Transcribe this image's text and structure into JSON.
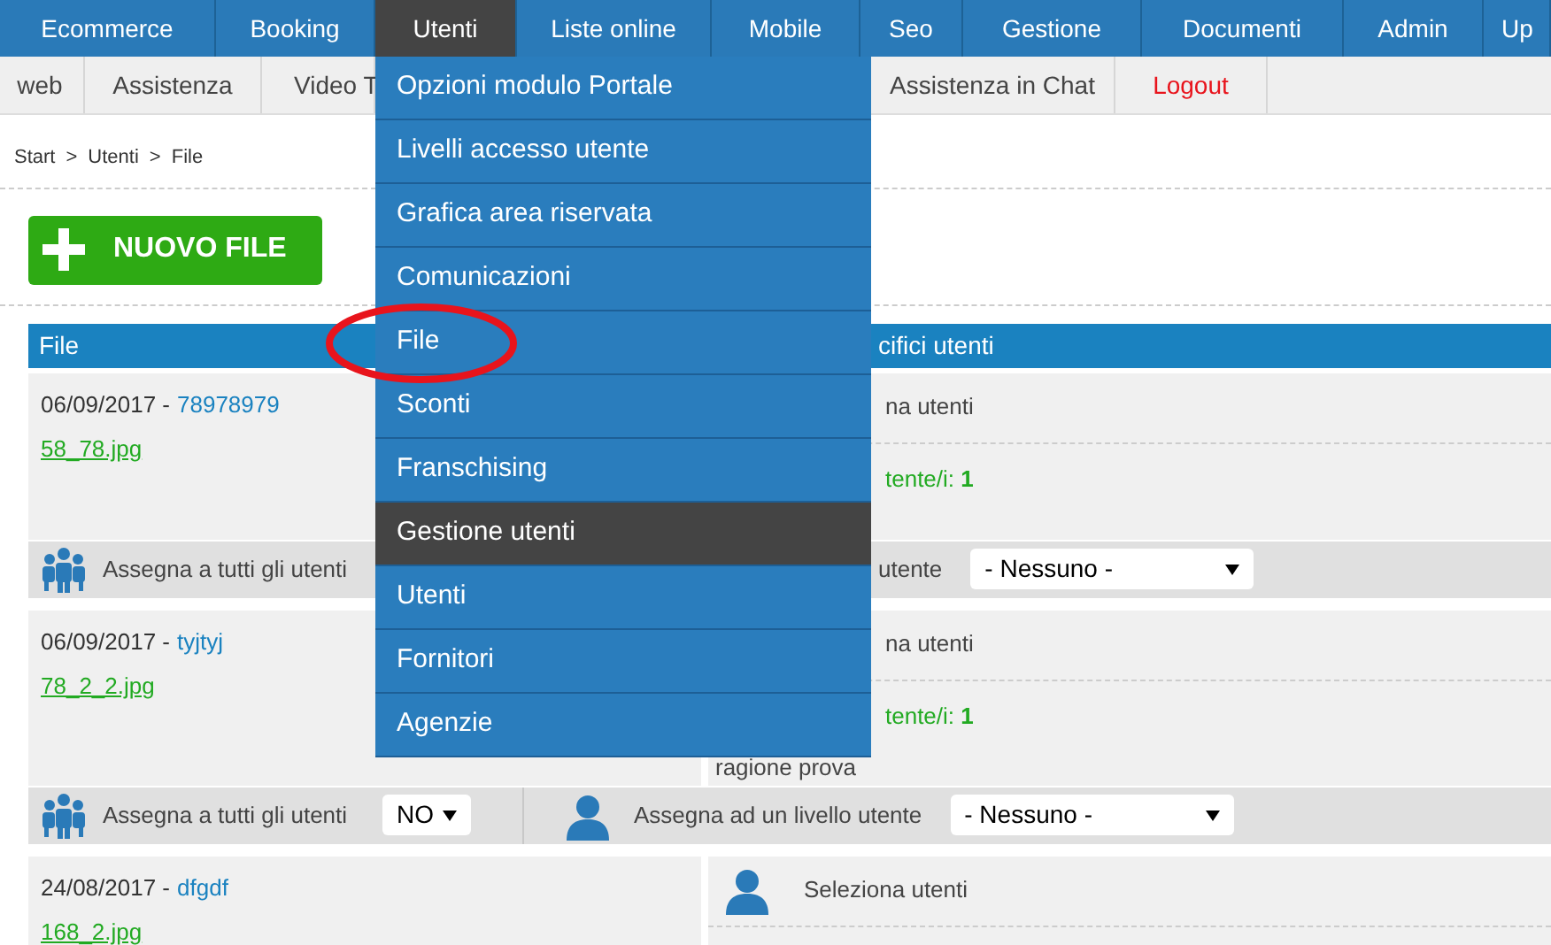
{
  "top_nav": [
    {
      "label": "Ecommerce",
      "selected": false
    },
    {
      "label": "Booking",
      "selected": false
    },
    {
      "label": "Utenti",
      "selected": true
    },
    {
      "label": "Liste online",
      "selected": false
    },
    {
      "label": "Mobile",
      "selected": false
    },
    {
      "label": "Seo",
      "selected": false
    },
    {
      "label": "Gestione",
      "selected": false
    },
    {
      "label": "Documenti",
      "selected": false
    },
    {
      "label": "Admin",
      "selected": false
    },
    {
      "label": "Up",
      "selected": false
    }
  ],
  "sub_nav": [
    {
      "label": "web",
      "kind": "normal"
    },
    {
      "label": "Assistenza",
      "kind": "normal"
    },
    {
      "label": "Video T",
      "kind": "normal"
    },
    {
      "label": "Assistenza in Chat",
      "kind": "normal"
    },
    {
      "label": "Logout",
      "kind": "logout"
    }
  ],
  "dropdown": [
    {
      "label": "Opzioni modulo Portale",
      "selected": false
    },
    {
      "label": "Livelli accesso utente",
      "selected": false
    },
    {
      "label": "Grafica area riservata",
      "selected": false
    },
    {
      "label": "Comunicazioni",
      "selected": false
    },
    {
      "label": "File",
      "selected": false,
      "circled": true
    },
    {
      "label": "Sconti",
      "selected": false
    },
    {
      "label": "Franschising",
      "selected": false
    },
    {
      "label": "Gestione utenti",
      "selected": true
    },
    {
      "label": "Utenti",
      "selected": false
    },
    {
      "label": "Fornitori",
      "selected": false
    },
    {
      "label": "Agenzie",
      "selected": false
    }
  ],
  "breadcrumb": [
    "Start",
    ">",
    "Utenti",
    ">",
    "File"
  ],
  "new_button": {
    "label": "NUOVO FILE"
  },
  "table": {
    "columns": [
      "File",
      "cifici utenti"
    ],
    "rows": [
      {
        "date": "06/09/2017 -",
        "title": "78978979",
        "file": "58_78.jpg",
        "select_users": {
          "label": "na utenti",
          "icon": false
        },
        "users": "tente/i: **1**",
        "assign": {
          "all_label": "Assegna a tutti gli utenti",
          "level_icon": false,
          "level_label": "utente",
          "level_value": "- Nessuno -"
        }
      },
      {
        "date": "06/09/2017 -",
        "title": "tyjtyj",
        "file": "78_2_2.jpg",
        "select_users": {
          "label": "na utenti",
          "icon": false
        },
        "users": "tente/i: **1**",
        "reason": "ragione prova",
        "assign": {
          "all_label": "Assegna a tutti gli utenti",
          "all_value": "NO",
          "level_icon": true,
          "level_label": "Assegna ad un livello utente",
          "level_value": "- Nessuno -"
        }
      },
      {
        "date": "24/08/2017 -",
        "title": "dfgdf",
        "file": "168_2.jpg",
        "select_users": {
          "label": "Seleziona utenti",
          "icon": true
        }
      }
    ]
  }
}
